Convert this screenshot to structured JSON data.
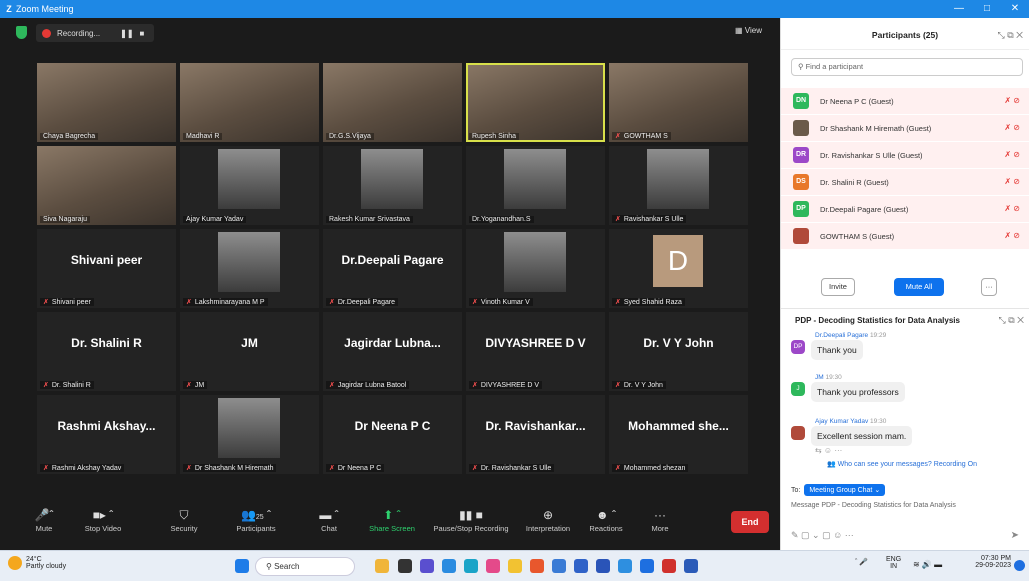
{
  "window": {
    "app_title": "Zoom Meeting"
  },
  "topbar": {
    "recording_label": "Recording...",
    "view_label": "View"
  },
  "tiles": [
    {
      "kind": "video",
      "caption": "Chaya Bagrecha",
      "muted": false
    },
    {
      "kind": "video",
      "caption": "Madhavi R",
      "muted": false
    },
    {
      "kind": "video",
      "caption": "Dr.G.S.Vijaya",
      "muted": false
    },
    {
      "kind": "video",
      "caption": "Rupesh Sinha",
      "muted": false,
      "active": true
    },
    {
      "kind": "video",
      "caption": "GOWTHAM S",
      "muted": true
    },
    {
      "kind": "video",
      "caption": "Siva Nagaraju",
      "muted": false
    },
    {
      "kind": "photo",
      "caption": "Ajay Kumar Yadav",
      "muted": false
    },
    {
      "kind": "photo",
      "caption": "Rakesh Kumar Srivastava",
      "muted": false
    },
    {
      "kind": "photo",
      "caption": "Dr.Yoganandhan.S",
      "muted": false
    },
    {
      "kind": "photo",
      "caption": "Ravishankar S Ulle",
      "muted": true
    },
    {
      "kind": "name",
      "big": "Shivani peer",
      "caption": "Shivani peer",
      "muted": true
    },
    {
      "kind": "photo",
      "caption": "Lakshminarayana M P",
      "muted": true
    },
    {
      "kind": "name",
      "big": "Dr.Deepali Pagare",
      "caption": "Dr.Deepali Pagare",
      "muted": true
    },
    {
      "kind": "photo",
      "caption": "Vinoth Kumar V",
      "muted": true
    },
    {
      "kind": "letter",
      "letter": "D",
      "caption": "Syed Shahid Raza",
      "muted": true
    },
    {
      "kind": "name",
      "big": "Dr. Shalini R",
      "caption": "Dr. Shalini R",
      "muted": true
    },
    {
      "kind": "name",
      "big": "JM",
      "caption": "JM",
      "muted": true
    },
    {
      "kind": "name",
      "big": "Jagirdar Lubna...",
      "caption": "Jagirdar Lubna Batool",
      "muted": true
    },
    {
      "kind": "name",
      "big": "DIVYASHREE D V",
      "caption": "DIVYASHREE D V",
      "muted": true
    },
    {
      "kind": "name",
      "big": "Dr. V Y John",
      "caption": "Dr. V Y John",
      "muted": true
    },
    {
      "kind": "name",
      "big": "Rashmi Akshay...",
      "caption": "Rashmi Akshay Yadav",
      "muted": true
    },
    {
      "kind": "photo",
      "caption": "Dr Shashank M Hiremath",
      "muted": true
    },
    {
      "kind": "name",
      "big": "Dr Neena P C",
      "caption": "Dr Neena P C",
      "muted": true
    },
    {
      "kind": "name",
      "big": "Dr. Ravishankar...",
      "caption": "Dr. Ravishankar S Ulle",
      "muted": true
    },
    {
      "kind": "name",
      "big": "Mohammed she...",
      "caption": "Mohammed shezan",
      "muted": true
    }
  ],
  "toolbar": {
    "mute": "Mute",
    "stop_video": "Stop Video",
    "security": "Security",
    "participants": "Participants",
    "participants_count": "25",
    "chat": "Chat",
    "share_screen": "Share Screen",
    "pause_recording": "Pause/Stop Recording",
    "interpretation": "Interpretation",
    "reactions": "Reactions",
    "more": "More",
    "end": "End"
  },
  "participants_panel": {
    "title": "Participants (25)",
    "search_placeholder": "Find a participant",
    "rows": [
      {
        "initials": "DN",
        "name": "Dr Neena P C (Guest)",
        "color": "#2eb85c"
      },
      {
        "initials": "",
        "name": "Dr Shashank M Hiremath (Guest)",
        "color": "#6b5a4a"
      },
      {
        "initials": "DR",
        "name": "Dr. Ravishankar S Ulle (Guest)",
        "color": "#9c48c8"
      },
      {
        "initials": "DS",
        "name": "Dr. Shalini R (Guest)",
        "color": "#e8782a"
      },
      {
        "initials": "DP",
        "name": "Dr.Deepali Pagare (Guest)",
        "color": "#2eb85c"
      },
      {
        "initials": "",
        "name": "GOWTHAM S (Guest)",
        "color": "#b04a3a"
      }
    ],
    "invite": "Invite",
    "mute_all": "Mute All",
    "more": "···"
  },
  "chat_panel": {
    "title": "PDP - Decoding Statistics for Data Analysis",
    "messages": [
      {
        "initials": "DP",
        "sender": "Dr.Deepali Pagare",
        "time": "19:29",
        "text": "Thank you",
        "color": "#9c48c8"
      },
      {
        "initials": "J",
        "sender": "JM",
        "time": "19:30",
        "text": "Thank you professors",
        "color": "#2eb85c"
      },
      {
        "initials": "",
        "sender": "Ajay Kumar Yadav",
        "time": "19:30",
        "text": "Excellent session  mam.",
        "color": "#b04a3a"
      }
    ],
    "who_can_see": "Who can see your messages? Recording On",
    "to_label": "To:",
    "to_value": "Meeting Group Chat",
    "message_placeholder": "Message PDP - Decoding Statistics for Data Analysis"
  },
  "taskbar": {
    "temperature": "24°C",
    "weather": "Partly cloudy",
    "search": "Search",
    "lang1": "ENG",
    "lang2": "IN",
    "time": "07:30 PM",
    "date": "29-09-2023"
  }
}
